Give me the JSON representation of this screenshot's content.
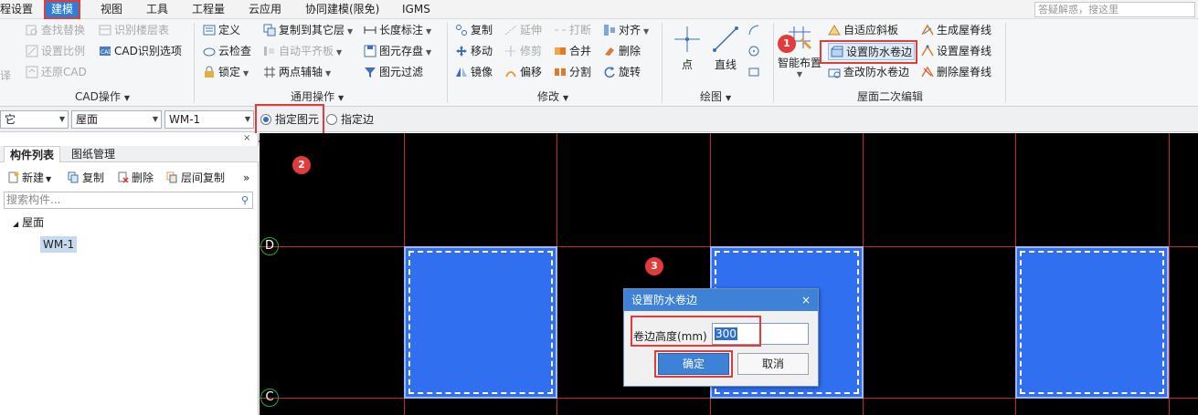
{
  "menu": {
    "items": [
      "程设置",
      "建模",
      "视图",
      "工具",
      "工程量",
      "云应用",
      "协同建模(限免)",
      "IGMS"
    ],
    "active": "建模",
    "search_placeholder": "答疑解惑，搜这里"
  },
  "ribbon": {
    "cad": {
      "items": [
        "查找替换",
        "识别楼层表",
        "设置比例",
        "CAD识别选项",
        "还原CAD"
      ],
      "label": "CAD操作",
      "edge_glyph": "译"
    },
    "common": {
      "items": [
        "定义",
        "复制到其它层",
        "长度标注",
        "云检查",
        "自动平齐板",
        "图元存盘",
        "锁定",
        "两点辅轴",
        "图元过滤"
      ],
      "label": "通用操作"
    },
    "modify": {
      "items": [
        "复制",
        "延伸",
        "打断",
        "对齐",
        "移动",
        "修剪",
        "合并",
        "删除",
        "镜像",
        "偏移",
        "分割",
        "旋转"
      ],
      "label": "修改"
    },
    "draw": {
      "items": [
        "点",
        "直线"
      ],
      "label": "绘图"
    },
    "roof": {
      "smart": "智能布置",
      "items": [
        "自适应斜板",
        "生成屋脊线",
        "设置防水卷边",
        "设置屋脊线",
        "查改防水卷边",
        "删除屋脊线"
      ],
      "label": "屋面二次编辑"
    }
  },
  "toolbar": {
    "combo_edge": "它",
    "combo_type": "屋面",
    "combo_element": "WM-1",
    "radio_selected": "指定图元",
    "radio_other": "指定边"
  },
  "left_panel": {
    "tabs": [
      "构件列表",
      "图纸管理"
    ],
    "actions": [
      "新建",
      "复制",
      "删除",
      "层间复制"
    ],
    "more": "»",
    "close": "×",
    "search_placeholder": "搜索构件...",
    "tree_root": "屋面",
    "tree_child": "WM-1"
  },
  "canvas": {
    "axis_labels": [
      "D",
      "C"
    ],
    "badges": [
      "1",
      "2",
      "3"
    ]
  },
  "dialog": {
    "title": "设置防水卷边",
    "close": "×",
    "label": "卷边高度(mm)",
    "value": "300",
    "ok": "确定",
    "cancel": "取消"
  },
  "colors": {
    "accent": "#3d82d6",
    "highlight_box": "#e23b3b",
    "slab": "#2f6ff0",
    "grid_line": "#c3262b",
    "canvas_bg": "#000000"
  }
}
